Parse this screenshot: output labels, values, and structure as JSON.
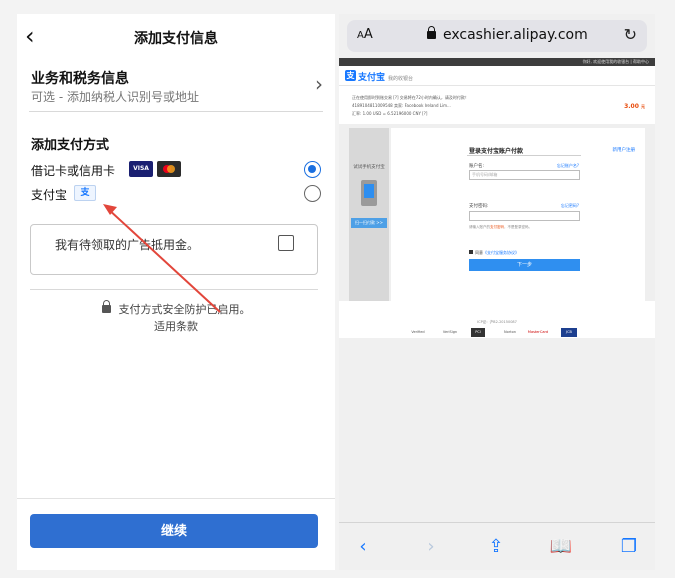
{
  "left": {
    "nav": {
      "title": "添加支付信息",
      "back_glyph": "‹"
    },
    "tax_row": {
      "title": "业务和税务信息",
      "subtitle": "可选 - 添加纳税人识别号或地址",
      "chevron": "›"
    },
    "section_title": "添加支付方式",
    "options": [
      {
        "label": "借记卡或信用卡",
        "selected": true,
        "badges": [
          "VISA",
          "mastercard"
        ]
      },
      {
        "label": "支付宝",
        "selected": false,
        "badge_icon": "alipay-icon",
        "badge_glyph": "支"
      }
    ],
    "coupon": {
      "text": "我有待领取的广告抵用金。",
      "checked": false
    },
    "secure_text": "支付方式安全防护已启用。",
    "terms_text": "适用条款",
    "continue_label": "继续",
    "annotation": {
      "type": "red-arrow",
      "color": "#e2463b",
      "target": "alipay-option"
    }
  },
  "right": {
    "browser": {
      "aa_label": "A",
      "aa_big": "A",
      "url": "excashier.alipay.com",
      "reload_glyph": "↻"
    },
    "page": {
      "top_links": "你好, 欢迎使用我的收银台 | 帮助中心",
      "logo_text": "支付宝",
      "logo_glyph": "支",
      "logo_sub": "我的收银台",
      "info_line1": "正在使用即时到账交易 [?]  交易将在72小时内确认，请及时付款！",
      "info_line2": "4189104811009548    卖家: Facebook Ireland Lim...",
      "info_line3": "汇率: 1.00 USD = 6.52196000 CNY [?]",
      "amount": "3.00",
      "amount_unit": "元",
      "scan_caption": "试试手机支付宝",
      "scan_button": "扫一扫付款 >>",
      "form_title": "登录支付宝账户付款",
      "register_link": "新用户注册",
      "account_label": "账户名:",
      "account_link": "忘记账户名?",
      "account_placeholder": "手机号码/邮箱",
      "password_label": "支付密码:",
      "password_link": "忘记密码?",
      "password_hint_pre": "请输入账户的",
      "password_hint_red": "支付密码",
      "password_hint_post": "，不是登录密码。",
      "agree_pre": "同意",
      "agree_link": "《支付宝服务协议》",
      "next_label": "下一步",
      "footer": "ICP证：沪B2-20150087",
      "badges": [
        "Verified",
        "VeriSign",
        "PCI",
        "Norton",
        "MasterCard SecureCode",
        "JCB"
      ]
    },
    "toolbar": [
      {
        "name": "back",
        "glyph": "‹"
      },
      {
        "name": "forward",
        "glyph": "›"
      },
      {
        "name": "share",
        "glyph": "⇪"
      },
      {
        "name": "bookmarks",
        "glyph": "📖"
      },
      {
        "name": "tabs",
        "glyph": "❐"
      }
    ]
  }
}
